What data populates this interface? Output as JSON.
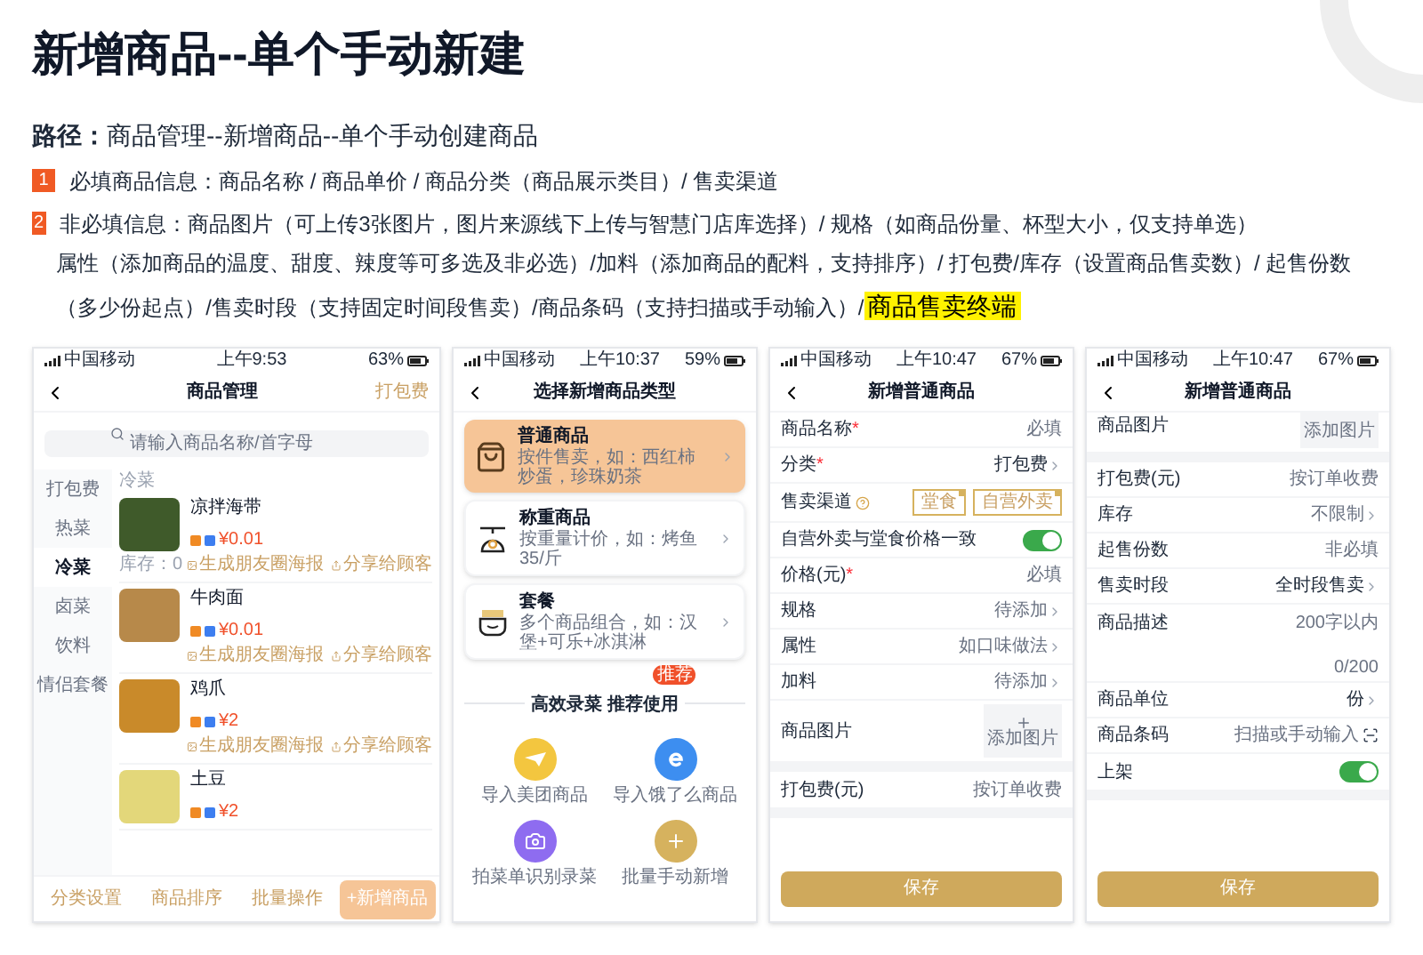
{
  "title": "新增商品--单个手动新建",
  "path": {
    "label": "路径：",
    "text": "商品管理--新增商品--单个手动创建商品"
  },
  "notes": [
    {
      "number": "1",
      "text": "必填商品信息：商品名称 / 商品单价 / 商品分类（商品展示类目）/ 售卖渠道"
    },
    {
      "number": "2",
      "text": "非必填信息：商品图片（可上传3张图片，图片来源线下上传与智慧门店库选择）/ 规格（如商品份量、杯型大小，仅支持单选）",
      "continuation": "属性（添加商品的温度、甜度、辣度等可多选及非必选）/加料（添加商品的配料，支持排序）/ 打包费/库存（设置商品售卖数）/ 起售份数（多少份起点）/售卖时段（支持固定时间段售卖）/商品条码（支持扫描或手动输入）/",
      "highlight": "商品售卖终端"
    }
  ],
  "phones": [
    {
      "kind": "product_list",
      "status": {
        "carrier": "中国移动",
        "time": "上午9:53",
        "battery": "63%"
      },
      "title": "商品管理",
      "action": "打包费",
      "search": {
        "placeholder": "请输入商品名称/首字母"
      },
      "categories": [
        {
          "label": "打包费",
          "selected": false
        },
        {
          "label": "热菜",
          "selected": false
        },
        {
          "label": "冷菜",
          "selected": true
        },
        {
          "label": "卤菜",
          "selected": false
        },
        {
          "label": "饮料",
          "selected": false
        },
        {
          "label": "情侣套餐",
          "selected": false
        }
      ],
      "section": "冷菜",
      "products": [
        {
          "name": "凉拌海带",
          "price": "¥0.01",
          "color": "#3f5a2a",
          "stock": "库存：0",
          "actions": [
            "生成朋友圈海报",
            "分享给顾客"
          ]
        },
        {
          "name": "牛肉面",
          "price": "¥0.01",
          "color": "#b7894a",
          "actions": [
            "生成朋友圈海报",
            "分享给顾客"
          ]
        },
        {
          "name": "鸡爪",
          "price": "¥2",
          "color": "#c98a2a",
          "actions": [
            "生成朋友圈海报",
            "分享给顾客"
          ]
        },
        {
          "name": "土豆",
          "price": "¥2",
          "color": "#e3d77a"
        }
      ],
      "bottom": [
        {
          "label": "分类设置",
          "selected": false
        },
        {
          "label": "商品排序",
          "selected": false
        },
        {
          "label": "批量操作",
          "selected": false
        },
        {
          "label": "+新增商品",
          "selected": true
        }
      ]
    },
    {
      "kind": "type_picker",
      "status": {
        "carrier": "中国移动",
        "time": "上午10:37",
        "battery": "59%"
      },
      "title": "选择新增商品类型",
      "types": [
        {
          "kind": "bag",
          "title": "普通商品",
          "desc": "按件售卖，如：西红柿炒蛋，珍珠奶茶",
          "selected": true
        },
        {
          "kind": "scale",
          "title": "称重商品",
          "desc": "按重量计价，如：烤鱼35/斤",
          "selected": false
        },
        {
          "kind": "box",
          "title": "套餐",
          "desc": "多个商品组合，如：汉堡+可乐+冰淇淋",
          "selected": false
        }
      ],
      "section": "高效录菜 推荐使用",
      "badge": "推荐",
      "tools": [
        {
          "kind": "plane",
          "label": "导入美团商品",
          "color": "#f3c63f"
        },
        {
          "kind": "e",
          "label": "导入饿了么商品",
          "color": "#3d8ef0"
        },
        {
          "kind": "camera",
          "label": "拍菜单识别录菜",
          "color": "#8e6cf0"
        },
        {
          "kind": "plus",
          "label": "批量手动新增",
          "color": "#d6b25e"
        }
      ]
    },
    {
      "kind": "form",
      "status": {
        "carrier": "中国移动",
        "time": "上午10:47",
        "battery": "67%"
      },
      "title": "新增普通商品",
      "groups": [
        [
          {
            "kind": "input",
            "label": "商品名称",
            "mark": "*",
            "placeholder": "必填"
          },
          {
            "kind": "select",
            "label": "分类",
            "mark": "*",
            "value": "打包费"
          },
          {
            "kind": "tags",
            "label": "售卖渠道",
            "tags": [
              {
                "label": "堂食",
                "selected": true
              },
              {
                "label": "自营外卖",
                "selected": true
              }
            ]
          },
          {
            "kind": "toggle",
            "label": "自营外卖与堂食价格一致",
            "on": true
          },
          {
            "kind": "input",
            "label": "价格(元)",
            "mark": "*",
            "placeholder": "必填"
          },
          {
            "kind": "select",
            "label": "规格",
            "placeholder": "待添加"
          },
          {
            "kind": "select",
            "label": "属性",
            "placeholder": "如口味做法"
          },
          {
            "kind": "select",
            "label": "加料",
            "placeholder": "待添加"
          },
          {
            "kind": "image",
            "label": "商品图片",
            "placeholder": "添加图片"
          }
        ],
        [
          {
            "kind": "input",
            "label": "打包费(元)",
            "placeholder": "按订单收费"
          }
        ]
      ],
      "button": "保存"
    },
    {
      "kind": "form",
      "status": {
        "carrier": "中国移动",
        "time": "上午10:47",
        "battery": "67%"
      },
      "title": "新增普通商品",
      "groups": [
        [
          {
            "kind": "image_cut",
            "label": "商品图片",
            "placeholder": "添加图片"
          }
        ],
        [
          {
            "kind": "input",
            "label": "打包费(元)",
            "placeholder": "按订单收费"
          },
          {
            "kind": "select",
            "label": "库存",
            "placeholder": "不限制"
          },
          {
            "kind": "input",
            "label": "起售份数",
            "placeholder": "非必填"
          },
          {
            "kind": "select",
            "label": "售卖时段",
            "value": "全时段售卖"
          },
          {
            "kind": "textarea",
            "label": "商品描述",
            "placeholder": "200字以内",
            "counter": "0/200"
          },
          {
            "kind": "select",
            "label": "商品单位",
            "value": "份"
          },
          {
            "kind": "scan",
            "label": "商品条码",
            "placeholder": "扫描或手动输入"
          },
          {
            "kind": "toggle",
            "label": "上架",
            "on": true
          }
        ]
      ],
      "button": "保存"
    }
  ]
}
